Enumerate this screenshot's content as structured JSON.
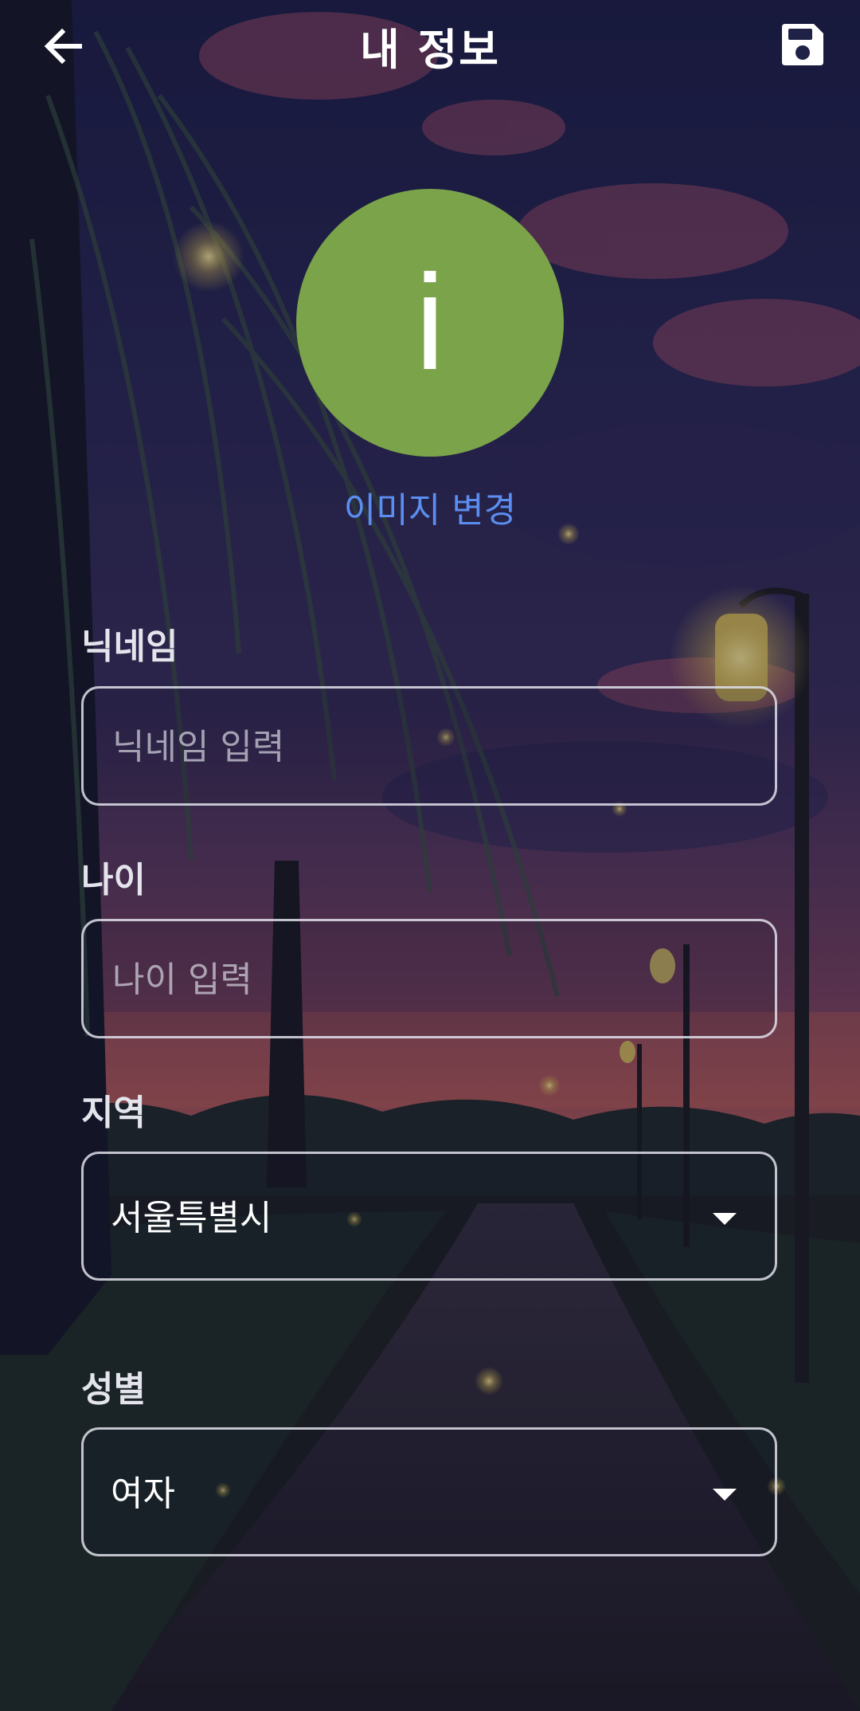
{
  "header": {
    "title": "내 정보",
    "back_icon": "arrow-left-icon",
    "save_icon": "floppy-disk-icon"
  },
  "profile": {
    "avatar_letter": "i",
    "avatar_color": "#7aa34a",
    "change_image_label": "이미지 변경",
    "change_image_color": "#5b8ef0"
  },
  "form": {
    "nickname": {
      "label": "닉네임",
      "placeholder": "닉네임 입력"
    },
    "age": {
      "label": "나이",
      "placeholder": "나이 입력"
    },
    "region": {
      "label": "지역",
      "value": "서울특별시",
      "icon": "dropdown-caret-icon"
    },
    "gender": {
      "label": "성별",
      "value": "여자",
      "icon": "dropdown-caret-icon"
    }
  }
}
